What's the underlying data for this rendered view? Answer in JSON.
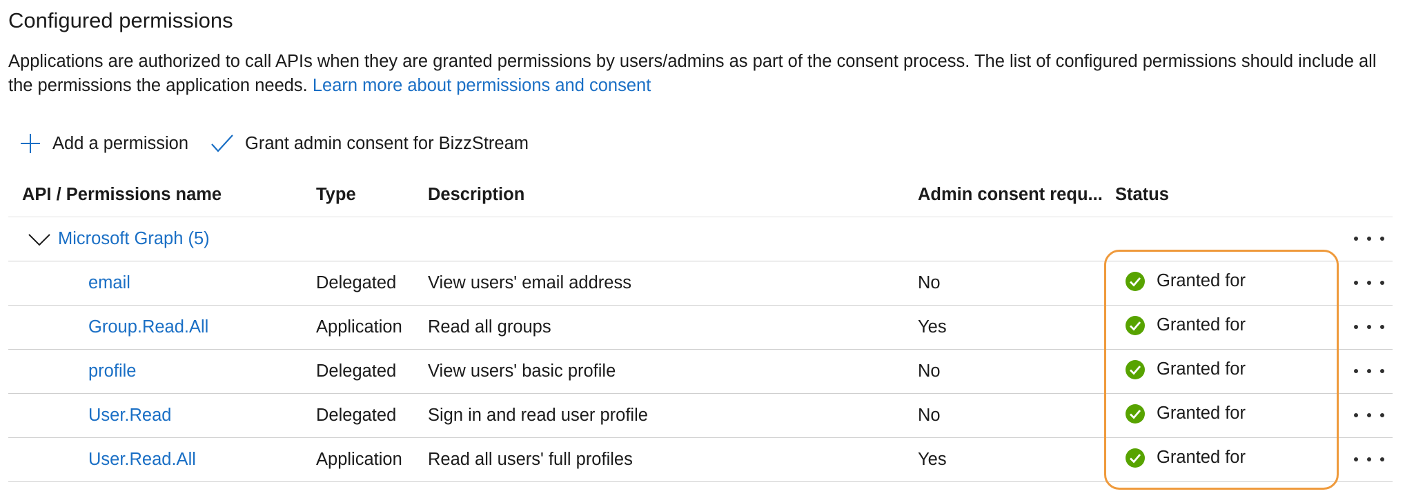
{
  "page": {
    "title": "Configured permissions",
    "description": "Applications are authorized to call APIs when they are granted permissions by users/admins as part of the consent process. The list of configured permissions should include all the permissions the application needs.",
    "learn_more_link": "Learn more about permissions and consent"
  },
  "toolbar": {
    "add_permission_label": "Add a permission",
    "grant_consent_label": "Grant admin consent for BizzStream"
  },
  "table": {
    "columns": [
      "API / Permissions name",
      "Type",
      "Description",
      "Admin consent requ...",
      "Status"
    ],
    "group": {
      "label": "Microsoft Graph (5)"
    },
    "rows": [
      {
        "name": "email",
        "type": "Delegated",
        "description": "View users' email address",
        "admin_consent": "No",
        "status": "Granted for"
      },
      {
        "name": "Group.Read.All",
        "type": "Application",
        "description": "Read all groups",
        "admin_consent": "Yes",
        "status": "Granted for"
      },
      {
        "name": "profile",
        "type": "Delegated",
        "description": "View users' basic profile",
        "admin_consent": "No",
        "status": "Granted for"
      },
      {
        "name": "User.Read",
        "type": "Delegated",
        "description": "Sign in and read user profile",
        "admin_consent": "No",
        "status": "Granted for"
      },
      {
        "name": "User.Read.All",
        "type": "Application",
        "description": "Read all users' full profiles",
        "admin_consent": "Yes",
        "status": "Granted for"
      }
    ]
  },
  "icons": {
    "add": "plus-icon",
    "grant": "checkmark-icon",
    "expand": "chevron-down-icon",
    "status": "success-check-icon",
    "more": "more-icon"
  },
  "colors": {
    "link": "#1a6fc5",
    "success": "#57a300",
    "highlight": "#ef9a3c",
    "text": "#1b1b1b"
  }
}
